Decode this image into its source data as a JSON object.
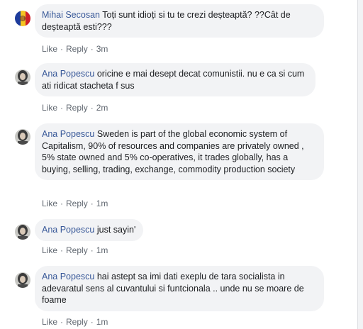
{
  "comments": [
    {
      "author": "Mihai Secosan",
      "avatar": "flag-avatar",
      "text": "Toți sunt idioți si tu te crezi deșteaptă? ??Cât de deșteaptă esti???",
      "like": "Like",
      "reply": "Reply",
      "time": "3m"
    },
    {
      "author": "Ana Popescu",
      "avatar": "portrait-avatar",
      "text": "oricine e mai desept decat comunistii. nu e ca si cum ati ridicat stacheta f sus",
      "like": "Like",
      "reply": "Reply",
      "time": "2m"
    },
    {
      "author": "Ana Popescu",
      "avatar": "portrait-avatar",
      "text": "Sweden is part of the global economic system of Capitalism, 90% of resources and companies are privately owned , 5% state owned and 5% co-operatives, it trades globally, has a buying, selling, trading, exchange, commodity production society",
      "like": "Like",
      "reply": "Reply",
      "time": "1m"
    },
    {
      "author": "Ana Popescu",
      "avatar": "portrait-avatar",
      "text": "just sayin'",
      "like": "Like",
      "reply": "Reply",
      "time": "1m"
    },
    {
      "author": "Ana Popescu",
      "avatar": "portrait-avatar",
      "text": "hai astept sa imi dati exeplu de tara socialista in adevaratul sens al cuvantului si funtcionala .. unde nu se moare de foame",
      "like": "Like",
      "reply": "Reply",
      "time": "1m"
    }
  ]
}
